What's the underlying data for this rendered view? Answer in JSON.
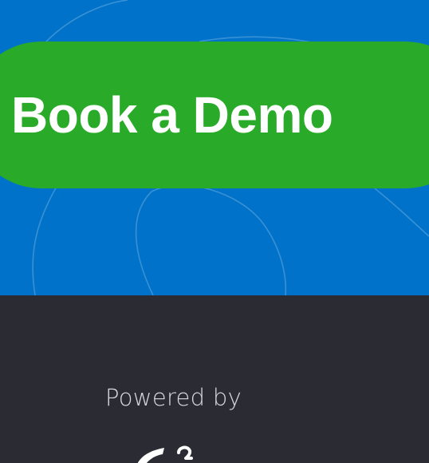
{
  "hero": {
    "background_color": "#0072c9",
    "cta": {
      "label": "Book a Demo",
      "color": "#29ab29"
    }
  },
  "footer": {
    "background_color": "#2a2b33",
    "powered_by": "Powered by",
    "logo_icon": "brand-logo-icon"
  }
}
